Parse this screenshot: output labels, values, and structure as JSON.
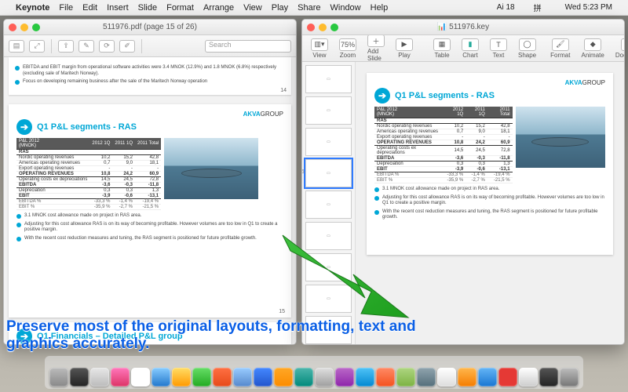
{
  "menubar": {
    "apple": "",
    "app": "Keynote",
    "items": [
      "File",
      "Edit",
      "Insert",
      "Slide",
      "Format",
      "Arrange",
      "View",
      "Play",
      "Share",
      "Window",
      "Help"
    ],
    "right": [
      "Ai 18",
      "",
      "",
      "",
      "拼",
      "",
      "",
      "",
      "",
      "Wed 5:23 PM",
      "",
      ""
    ]
  },
  "preview": {
    "title": "511976.pdf (page 15 of 26)",
    "search_placeholder": "Search",
    "top_fragment": {
      "line1": "EBITDA and EBIT margin from operational software activities were 3.4 MNOK (12.9%) and 1.8 MNOK (6.8%) respectively (excluding sale of Maritech Norway).",
      "line2": "Focus on developing remaining business after the sale of the Maritech Norway operation",
      "pagenum": "14"
    },
    "slide15": {
      "brand": "AKVAGROUP",
      "title": "Q1 P&L segments - RAS",
      "pagenum": "15",
      "table": {
        "header_main": "P&L 2012",
        "header_sub": "(MNOK)",
        "cols": [
          "2012 1Q",
          "2011 1Q",
          "2011 Total"
        ],
        "rows": [
          {
            "label": "RAS",
            "vals": [
              "",
              "",
              ""
            ],
            "cls": "bold"
          },
          {
            "label": "Nordic operating revenues",
            "vals": [
              "10,2",
              "15,2",
              "42,8"
            ]
          },
          {
            "label": "Americas operating revenues",
            "vals": [
              "0,7",
              "9,0",
              "18,1"
            ]
          },
          {
            "label": "Export operating revenues",
            "vals": [
              "-",
              "-",
              "-"
            ]
          },
          {
            "label": "OPERATING REVENUES",
            "vals": [
              "10,8",
              "24,2",
              "60,9"
            ],
            "cls": "bold"
          },
          {
            "label": "Operating costs ex depreciations",
            "vals": [
              "14,5",
              "24,5",
              "72,8"
            ]
          },
          {
            "label": "EBITDA",
            "vals": [
              "-3,6",
              "-0,3",
              "-11,8"
            ],
            "cls": "bold"
          },
          {
            "label": "Depreciation",
            "vals": [
              "0,3",
              "0,3",
              "1,3"
            ]
          },
          {
            "label": "EBIT",
            "vals": [
              "-3,9",
              "-0,6",
              "-13,1"
            ],
            "cls": "bold"
          }
        ],
        "foot": [
          {
            "label": "EBITDA %",
            "vals": [
              "-33,3 %",
              "-1,4 %",
              "-19,4 %"
            ]
          },
          {
            "label": "EBIT %",
            "vals": [
              "-35,9 %",
              "-2,7 %",
              "-21,5 %"
            ]
          }
        ]
      },
      "bullets": [
        "3.1 MNOK cost allowance made on project in RAS area.",
        "Adjusting for this cost allowance RAS is on its way of becoming profitable. However volumes are too low in Q1 to create a positive margin.",
        "With the recent cost reduction measures and tuning, the RAS segment is positioned for future profitable growth."
      ]
    },
    "slide16_title": "Q1 Financials – Detailed P&L group"
  },
  "keynote": {
    "title": "511976.key",
    "toolbar": {
      "view": "View",
      "zoom": "Zoom",
      "zoom_val": "75%",
      "add": "Add Slide",
      "play": "Play",
      "table": "Table",
      "chart": "Chart",
      "text": "Text",
      "shape": "Shape",
      "format": "Format",
      "animate": "Animate",
      "document": "Document"
    },
    "sel_thumb": "15",
    "canvas": {
      "brand": "AKVAGROUP",
      "title": "Q1 P&L segments - RAS",
      "bullets": [
        "3.1 MNOK cost allowance made on project in RAS area.",
        "Adjusting for this cost allowance RAS is on its way of becoming profitable. However volumes are too low in Q1 to create a positive margin.",
        "With the recent cost reduction measures and tuning, the RAS segment is positioned for future profitable growth."
      ]
    }
  },
  "caption": "Preserve most of the original layouts, formatting, text and graphics accurately.",
  "chart_data": {
    "type": "table",
    "title": "Q1 P&L segments - RAS",
    "columns": [
      "(MNOK)",
      "2012 1Q",
      "2011 1Q",
      "2011 Total"
    ],
    "rows": [
      [
        "Nordic operating revenues",
        10.2,
        15.2,
        42.8
      ],
      [
        "Americas operating revenues",
        0.7,
        9.0,
        18.1
      ],
      [
        "Export operating revenues",
        null,
        null,
        null
      ],
      [
        "OPERATING REVENUES",
        10.8,
        24.2,
        60.9
      ],
      [
        "Operating costs ex depreciations",
        14.5,
        24.5,
        72.8
      ],
      [
        "EBITDA",
        -3.6,
        -0.3,
        -11.8
      ],
      [
        "Depreciation",
        0.3,
        0.3,
        1.3
      ],
      [
        "EBIT",
        -3.9,
        -0.6,
        -13.1
      ],
      [
        "EBITDA %",
        -33.3,
        -1.4,
        -19.4
      ],
      [
        "EBIT %",
        -35.9,
        -2.7,
        -21.5
      ]
    ]
  }
}
